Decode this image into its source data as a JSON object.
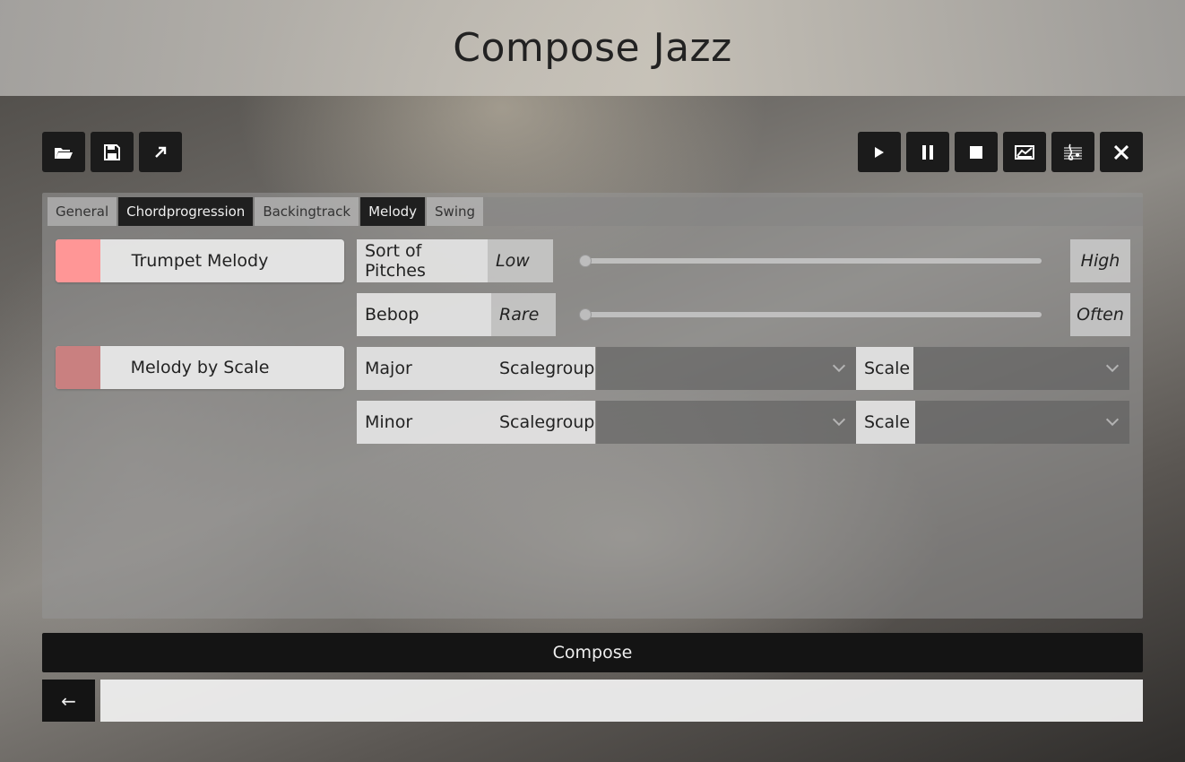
{
  "app": {
    "title": "Compose Jazz"
  },
  "toolbar": {
    "left": [
      {
        "name": "open-folder-icon"
      },
      {
        "name": "save-icon"
      },
      {
        "name": "export-arrow-icon"
      }
    ],
    "right": [
      {
        "name": "play-icon"
      },
      {
        "name": "pause-icon"
      },
      {
        "name": "stop-icon"
      },
      {
        "name": "chart-icon"
      },
      {
        "name": "score-icon"
      },
      {
        "name": "close-icon"
      }
    ]
  },
  "tabs": [
    {
      "label": "General",
      "active": false
    },
    {
      "label": "Chordprogression",
      "active": false
    },
    {
      "label": "Backingtrack",
      "active": false
    },
    {
      "label": "Melody",
      "active": true
    },
    {
      "label": "Swing",
      "active": false
    }
  ],
  "toggles": [
    {
      "label": "Trumpet Melody",
      "color": "#ff9696",
      "on": true
    },
    {
      "label": "Melody by Scale",
      "color": "#c98080",
      "on": false
    }
  ],
  "sliders": [
    {
      "label": "Sort of Pitches",
      "min_label": "Low",
      "max_label": "High",
      "value": 0.0
    },
    {
      "label": "Bebop",
      "min_label": "Rare",
      "max_label": "Often",
      "value": 0.0
    }
  ],
  "scales": [
    {
      "label": "Major",
      "group_label": "Scalegroup",
      "group_value": "",
      "scale_label": "Scale",
      "scale_value": ""
    },
    {
      "label": "Minor",
      "group_label": "Scalegroup",
      "group_value": "",
      "scale_label": "Scale",
      "scale_value": ""
    }
  ],
  "actions": {
    "compose_label": "Compose",
    "back_label": "←"
  },
  "status": {
    "text": ""
  }
}
